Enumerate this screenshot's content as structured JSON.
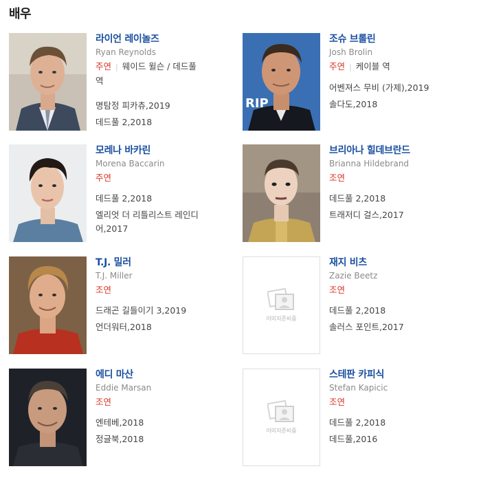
{
  "section_title": "배우",
  "no_image_text": "이미지준비중",
  "actors": [
    {
      "korean_name": "라이언 레이놀즈",
      "english_name": "Ryan Reynolds",
      "role_type": "주연",
      "character": "웨이드 윌슨 / 데드풀",
      "character_suffix": "역",
      "works": [
        "명탐정 피카츄,2019",
        "데드풀 2,2018"
      ]
    },
    {
      "korean_name": "조슈 브롤린",
      "english_name": "Josh Brolin",
      "role_type": "주연",
      "character": "케이블 역",
      "works": [
        "어벤져스 무비 (가제),2019",
        "솔다도,2018"
      ]
    },
    {
      "korean_name": "모레나 바카린",
      "english_name": "Morena Baccarin",
      "role_type": "주연",
      "character": "",
      "works": [
        "데드풀 2,2018",
        "엘리엇 더 리틀리스트 레인디",
        "어,2017"
      ]
    },
    {
      "korean_name": "브리아나 힐데브란드",
      "english_name": "Brianna Hildebrand",
      "role_type": "조연",
      "character": "",
      "works": [
        "데드풀 2,2018",
        "트래저디 걸스,2017"
      ]
    },
    {
      "korean_name": "T.J. 밀러",
      "english_name": "T.J. Miller",
      "role_type": "조연",
      "character": "",
      "works": [
        "드래곤 길들이기 3,2019",
        "언더워터,2018"
      ]
    },
    {
      "korean_name": "재지 비츠",
      "english_name": "Zazie Beetz",
      "role_type": "조연",
      "character": "",
      "works": [
        "데드풀 2,2018",
        "솔러스 포인트,2017"
      ]
    },
    {
      "korean_name": "에디 마산",
      "english_name": "Eddie Marsan",
      "role_type": "조연",
      "character": "",
      "works": [
        "엔테베,2018",
        "정글북,2018"
      ]
    },
    {
      "korean_name": "스테판 카피식",
      "english_name": "Stefan Kapicic",
      "role_type": "조연",
      "character": "",
      "works": [
        "데드풀 2,2018",
        "데드풀,2016"
      ]
    }
  ]
}
